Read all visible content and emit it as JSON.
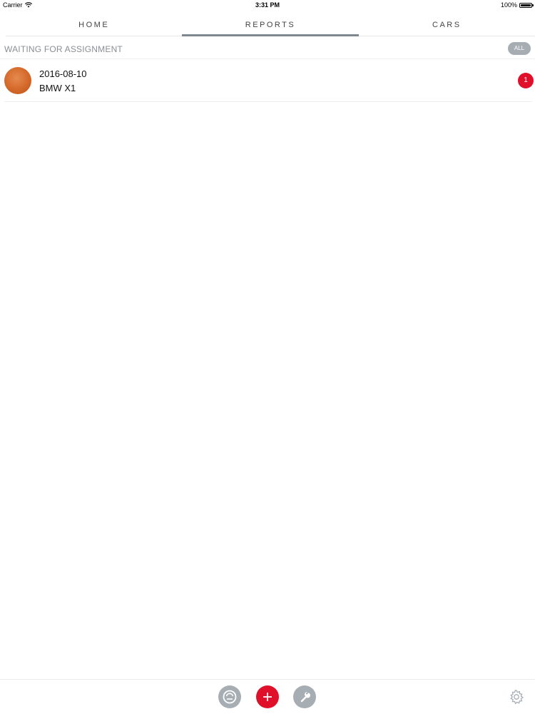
{
  "status_bar": {
    "carrier": "Carrier",
    "time": "3:31 PM",
    "battery": "100%"
  },
  "tabs": [
    {
      "label": "HOME",
      "active": false
    },
    {
      "label": "REPORTS",
      "active": true
    },
    {
      "label": "CARS",
      "active": false
    }
  ],
  "section": {
    "title": "WAITING FOR ASSIGNMENT",
    "all_label": "ALL"
  },
  "items": [
    {
      "date": "2016-08-10",
      "car": "BMW X1",
      "count": "1"
    }
  ],
  "toolbar": {
    "gauge_icon": "gauge-icon",
    "add_icon": "plus-icon",
    "wrench_icon": "wrench-icon",
    "settings_icon": "gear-icon"
  },
  "colors": {
    "accent": "#e0102b",
    "gray_button": "#a6adb3",
    "tab_indicator": "#7e8790"
  }
}
